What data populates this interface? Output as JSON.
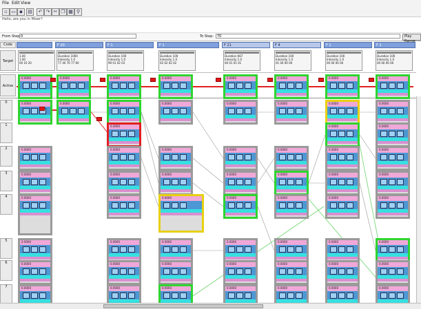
{
  "menu": {
    "file": "File",
    "edit": "Edit",
    "view": "View"
  },
  "message": "Hello, are you in Mixer?",
  "controls": {
    "from_label": "From Step:",
    "from_value": "0",
    "to_label": "To Step:",
    "to_value": "70",
    "play_label": "Play Range"
  },
  "row_labels": {
    "code": "Code",
    "target": "Target",
    "active": "Active"
  },
  "columns": [
    {
      "label": "",
      "light": false
    },
    {
      "label": "F 20",
      "light": false
    },
    {
      "label": "F 1",
      "light": false
    },
    {
      "label": "F 1",
      "light": false
    },
    {
      "label": "F 21",
      "light": true
    },
    {
      "label": "F 4",
      "light": true
    },
    {
      "label": "F 1",
      "light": false
    },
    {
      "label": "F 1",
      "light": false
    }
  ],
  "targets": [
    {
      "l1": "1.00",
      "l2": "1.00",
      "l3": "00 10 20"
    },
    {
      "l1": "Duration 1000",
      "l2": "Intensity 1.0",
      "l3": "77 40 70 77 60"
    },
    {
      "l1": "Duration 100",
      "l2": "Intensity 1.0",
      "l3": "99 01 02 03"
    },
    {
      "l1": "Duration 100",
      "l2": "Intensity 1.0",
      "l3": "02 02 02 02"
    },
    {
      "l1": "Duration 667",
      "l2": "Intensity 1.0",
      "l3": "00 01 01 01"
    },
    {
      "l1": "Duration 100",
      "l2": "Intensity 1.0",
      "l3": "01 00 00 00"
    },
    {
      "l1": "Duration 100",
      "l2": "Intensity 1.0",
      "l3": "00 00 00 00"
    },
    {
      "l1": "Duration 100",
      "l2": "Intensity 1.0",
      "l3": "00 00 00 00"
    }
  ],
  "grid_rows": [
    "0",
    "1",
    "2",
    "3",
    "4",
    "5",
    "6",
    "7"
  ],
  "node_text": "0.0000"
}
